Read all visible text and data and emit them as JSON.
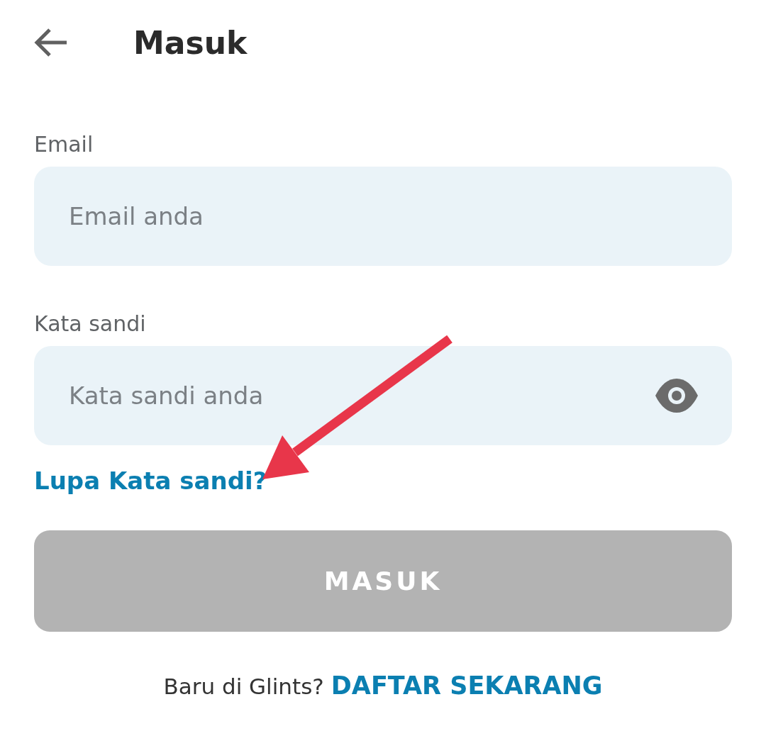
{
  "header": {
    "title": "Masuk"
  },
  "fields": [
    {
      "label": "Email",
      "placeholder": "Email anda",
      "kind": "text"
    },
    {
      "label": "Kata sandi",
      "placeholder": "Kata sandi anda",
      "kind": "password"
    }
  ],
  "forgot_link": "Lupa Kata sandi?",
  "submit_button": {
    "label": "MASUK",
    "disabled": true
  },
  "footer": {
    "text": "Baru di Glints?",
    "link": "DAFTAR SEKARANG"
  }
}
